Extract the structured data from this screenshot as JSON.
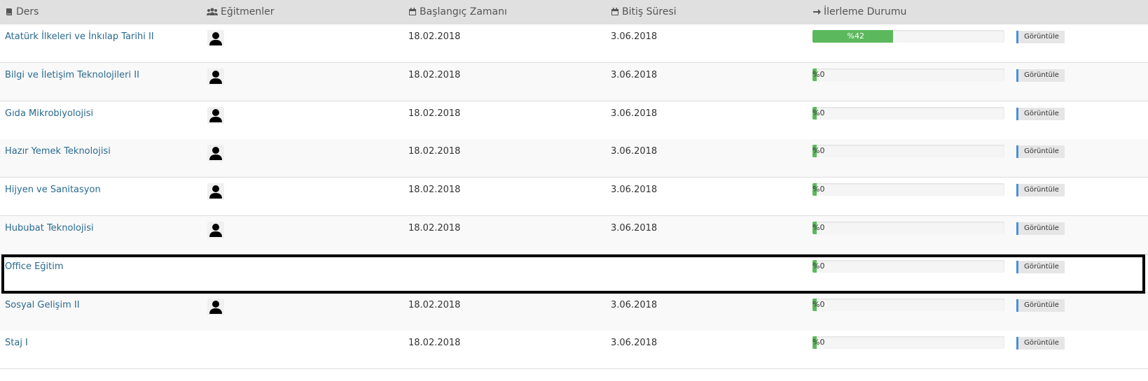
{
  "header": {
    "course": "Ders",
    "instructors": "Eğitmenler",
    "start": "Başlangıç Zamanı",
    "end": "Bitiş Süresi",
    "progress": "İlerleme Durumu"
  },
  "icons": {
    "course": "book-icon",
    "instructors": "users-icon",
    "start": "calendar-icon",
    "end": "calendar-icon",
    "progress": "arrow-right-icon",
    "avatar": "user-avatar-icon"
  },
  "colors": {
    "progress_fill": "#5cb85c",
    "link": "#2a6a8f",
    "button_accent": "#4a90d9",
    "header_bg": "#e0e0e0"
  },
  "rows": [
    {
      "course": "Atatürk İlkeleri ve İnkılap Tarihi II",
      "has_instructor": true,
      "start": "18.02.2018",
      "end": "3.06.2018",
      "progress_label": "%42",
      "progress": 0.42,
      "button": "Görüntüle"
    },
    {
      "course": "Bilgi ve İletişim Teknolojileri II",
      "has_instructor": true,
      "start": "18.02.2018",
      "end": "3.06.2018",
      "progress_label": "%0",
      "progress": 0,
      "button": "Görüntüle"
    },
    {
      "course": "Gıda Mikrobiyolojisi",
      "has_instructor": true,
      "start": "18.02.2018",
      "end": "3.06.2018",
      "progress_label": "%0",
      "progress": 0,
      "button": "Görüntüle"
    },
    {
      "course": "Hazır Yemek Teknolojisi",
      "has_instructor": true,
      "start": "18.02.2018",
      "end": "3.06.2018",
      "progress_label": "%0",
      "progress": 0,
      "button": "Görüntüle"
    },
    {
      "course": "Hijyen ve Sanitasyon",
      "has_instructor": true,
      "start": "18.02.2018",
      "end": "3.06.2018",
      "progress_label": "%0",
      "progress": 0,
      "button": "Görüntüle"
    },
    {
      "course": "Hububat Teknolojisi",
      "has_instructor": true,
      "start": "18.02.2018",
      "end": "3.06.2018",
      "progress_label": "%0",
      "progress": 0,
      "button": "Görüntüle"
    },
    {
      "course": "Office Eğitim",
      "has_instructor": false,
      "start": "",
      "end": "",
      "progress_label": "%0",
      "progress": 0,
      "button": "Görüntüle"
    },
    {
      "course": "Sosyal Gelişim II",
      "has_instructor": true,
      "start": "18.02.2018",
      "end": "3.06.2018",
      "progress_label": "%0",
      "progress": 0,
      "button": "Görüntüle"
    },
    {
      "course": "Staj I",
      "has_instructor": false,
      "start": "18.02.2018",
      "end": "3.06.2018",
      "progress_label": "%0",
      "progress": 0,
      "button": "Görüntüle"
    }
  ]
}
